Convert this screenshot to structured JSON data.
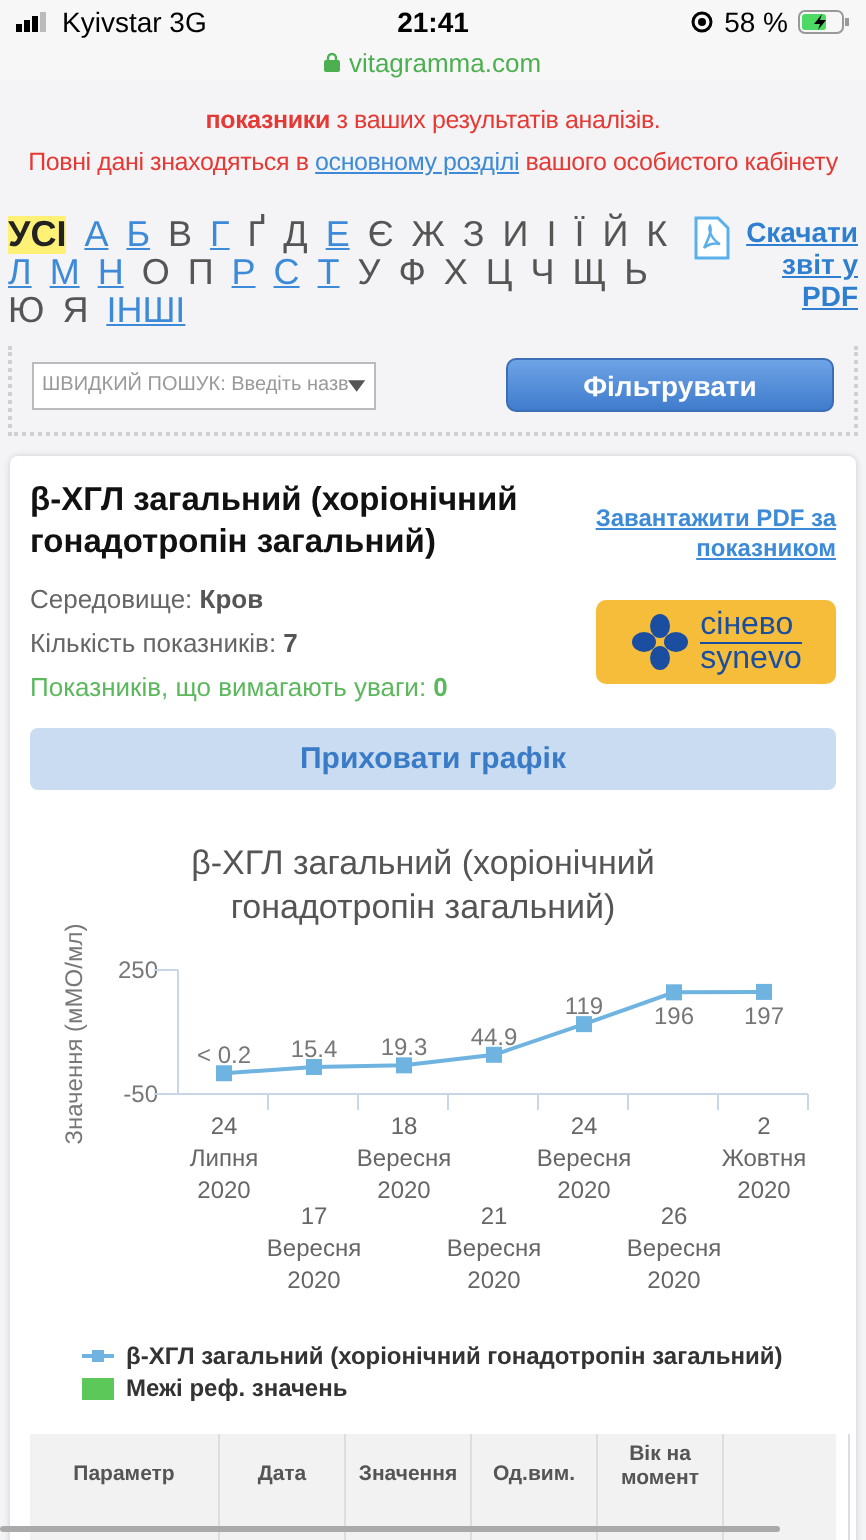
{
  "status_bar": {
    "carrier": "Kyivstar 3G",
    "time": "21:41",
    "battery": "58 %"
  },
  "address_bar": {
    "url": "vitagramma.com"
  },
  "notice": {
    "lines": [
      "**показники** з ваших результатів аналізів."
    ],
    "full_data": {
      "before": "Повні дані знаходяться в",
      "link": "основному розділі",
      "after": "вашого особистого кабінету"
    }
  },
  "alphabet": [
    {
      "label": "УСІ",
      "selected": true,
      "link": false
    },
    {
      "label": "А",
      "selected": false,
      "link": true
    },
    {
      "label": "Б",
      "selected": false,
      "link": true
    },
    {
      "label": "В",
      "selected": false,
      "link": false
    },
    {
      "label": "Г",
      "selected": false,
      "link": true
    },
    {
      "label": "Ґ",
      "selected": false,
      "link": false
    },
    {
      "label": "Д",
      "selected": false,
      "link": false
    },
    {
      "label": "Е",
      "selected": false,
      "link": true
    },
    {
      "label": "Є",
      "selected": false,
      "link": false
    },
    {
      "label": "Ж",
      "selected": false,
      "link": false
    },
    {
      "label": "З",
      "selected": false,
      "link": false
    },
    {
      "label": "И",
      "selected": false,
      "link": false
    },
    {
      "label": "І",
      "selected": false,
      "link": false
    },
    {
      "label": "Ї",
      "selected": false,
      "link": false
    },
    {
      "label": "Й",
      "selected": false,
      "link": false
    },
    {
      "label": "К",
      "selected": false,
      "link": false
    },
    {
      "label": "Л",
      "selected": false,
      "link": true
    },
    {
      "label": "М",
      "selected": false,
      "link": true
    },
    {
      "label": "Н",
      "selected": false,
      "link": true
    },
    {
      "label": "О",
      "selected": false,
      "link": false
    },
    {
      "label": "П",
      "selected": false,
      "link": false
    },
    {
      "label": "Р",
      "selected": false,
      "link": true
    },
    {
      "label": "С",
      "selected": false,
      "link": true
    },
    {
      "label": "Т",
      "selected": false,
      "link": true
    },
    {
      "label": "У",
      "selected": false,
      "link": false
    },
    {
      "label": "Ф",
      "selected": false,
      "link": false
    },
    {
      "label": "Х",
      "selected": false,
      "link": false
    },
    {
      "label": "Ц",
      "selected": false,
      "link": false
    },
    {
      "label": "Ч",
      "selected": false,
      "link": false
    },
    {
      "label": "Щ",
      "selected": false,
      "link": false
    },
    {
      "label": "Ь",
      "selected": false,
      "link": false
    },
    {
      "label": "Ю",
      "selected": false,
      "link": false
    },
    {
      "label": "Я",
      "selected": false,
      "link": false
    },
    {
      "label": "ІНШІ",
      "selected": false,
      "link": true
    }
  ],
  "download_report": "Скачати звіт у PDF",
  "search": {
    "placeholder": "ШВИДКИЙ ПОШУК: Введіть назв"
  },
  "filter_button": "Фільтрувати",
  "card": {
    "title": "β-ХГЛ загальний (хоріонічний гонадотропін загальний)",
    "pdf_link": "Завантажити PDF за показником",
    "logo": {
      "top": "сінево",
      "bottom": "synevo"
    },
    "info": [
      {
        "label": "Середовище:",
        "value": "Кров",
        "kind": "plain"
      },
      {
        "label": "Кількість показників:",
        "value": "7",
        "kind": "plain"
      },
      {
        "label": "Показників, що вимагають уваги:",
        "value": "0",
        "kind": "ok"
      }
    ],
    "hide_chart_button": "Приховати графік",
    "chart_data": {
      "type": "line",
      "title": "β-ХГЛ загальний (хоріонічний гонадотропін загальний)",
      "ylabel": "Значення (мМО/мл)",
      "categories": [
        "24 Липня 2020",
        "17 Вересня 2020",
        "18 Вересня 2020",
        "21 Вересня 2020",
        "24 Вересня 2020",
        "26 Вересня 2020",
        "2 Жовтня 2020"
      ],
      "series": [
        {
          "name": "β-ХГЛ загальний (хоріонічний гонадотропін загальний)",
          "color": "#6fb3e0",
          "values": [
            0.2,
            15.4,
            19.3,
            44.9,
            119,
            196,
            197
          ],
          "marker": "square"
        }
      ],
      "ylim": [
        -50,
        250
      ],
      "yticks": [
        -50,
        250
      ],
      "value_labels": [
        "< 0.2",
        "15.4",
        "19.3",
        "44.9",
        "119",
        "196",
        "197"
      ]
    },
    "legend_extra": {
      "label": "Межі реф. значень",
      "color": "#5cc85a"
    },
    "table": {
      "columns": [
        "Параметр",
        "Дата",
        "Значення",
        "Од.вим.",
        "Вік на момент"
      ]
    }
  }
}
